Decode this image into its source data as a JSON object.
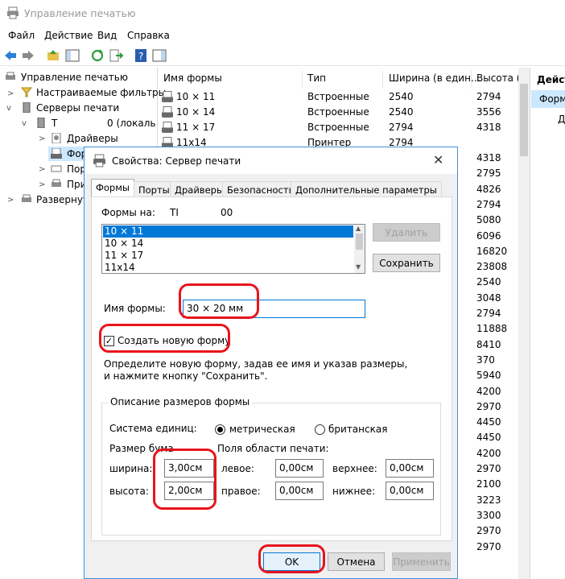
{
  "window": {
    "title": "Управление печатью"
  },
  "menu": [
    "Файл",
    "Действие",
    "Вид",
    "Справка"
  ],
  "tree": {
    "root": "Управление печатью",
    "filters": "Настраиваемые фильтры",
    "servers": "Серверы печати",
    "server": "T",
    "server_suffix": "0 (локаль",
    "drivers": "Драйверы",
    "forms": "Фор",
    "ports": "Пор",
    "printers": "При",
    "deployed": "Развернут"
  },
  "list": {
    "headers": [
      "Имя формы",
      "Тип",
      "Ширина (в един…",
      "Высота (в"
    ],
    "rows": [
      [
        "10 × 11",
        "Встроенные",
        "2540",
        "2794"
      ],
      [
        "10 × 14",
        "Встроенные",
        "2540",
        "3556"
      ],
      [
        "11 × 17",
        "Встроенные",
        "2794",
        "4318"
      ],
      [
        "11x14",
        "Принтер",
        "2794",
        ""
      ]
    ],
    "heights_continued": [
      "4318",
      "2795",
      "4826",
      "2794",
      "5080",
      "6096",
      "16820",
      "23808",
      "2540",
      "3048",
      "2794",
      "11888",
      "8410",
      "370",
      "5940",
      "4200",
      "2970",
      "4450",
      "4450",
      "4200",
      "2970",
      "2100",
      "3223",
      "3300",
      "2970",
      "2970"
    ]
  },
  "actions": {
    "header": "Дейст",
    "item": "Форм",
    "sub": "Д"
  },
  "dialog": {
    "title": "Свойства: Сервер печати",
    "tabs": [
      "Формы",
      "Порты",
      "Драйверы",
      "Безопасность",
      "Дополнительные параметры"
    ],
    "forms_on_label": "Формы на:",
    "forms_on_server": "TI",
    "forms_on_suffix": "00",
    "forms_list": [
      "10 × 11",
      "10 × 14",
      "11 × 17",
      "11x14"
    ],
    "delete_button": "Удалить",
    "save_button": "Сохранить",
    "form_name_label": "Имя формы:",
    "form_name_value": "30 × 20 мм",
    "create_new_label": "Создать новую форму",
    "hint_line1": "Определите новую форму, задав ее имя и указав размеры,",
    "hint_line2": "и нажмите кнопку \"Сохранить\".",
    "group_title": "Описание размеров формы",
    "units_label": "Система единиц:",
    "metric": "метрическая",
    "british": "британская",
    "paper_size_label": "Размер бумаги:",
    "margins_label": "Поля области печати:",
    "width_label": "ширина:",
    "width_value": "3,00см",
    "height_label": "высота:",
    "height_value": "2,00см",
    "left_label": "левое:",
    "left_value": "0,00см",
    "right_label": "правое:",
    "right_value": "0,00см",
    "top_label": "верхнее:",
    "top_value": "0,00см",
    "bottom_label": "нижнее:",
    "bottom_value": "0,00см",
    "ok": "OK",
    "cancel": "Отмена",
    "apply": "Применить"
  },
  "colors": {
    "selection": "#0078d7",
    "highlight": "#e8141c",
    "accent_border": "#3c8fd8"
  }
}
